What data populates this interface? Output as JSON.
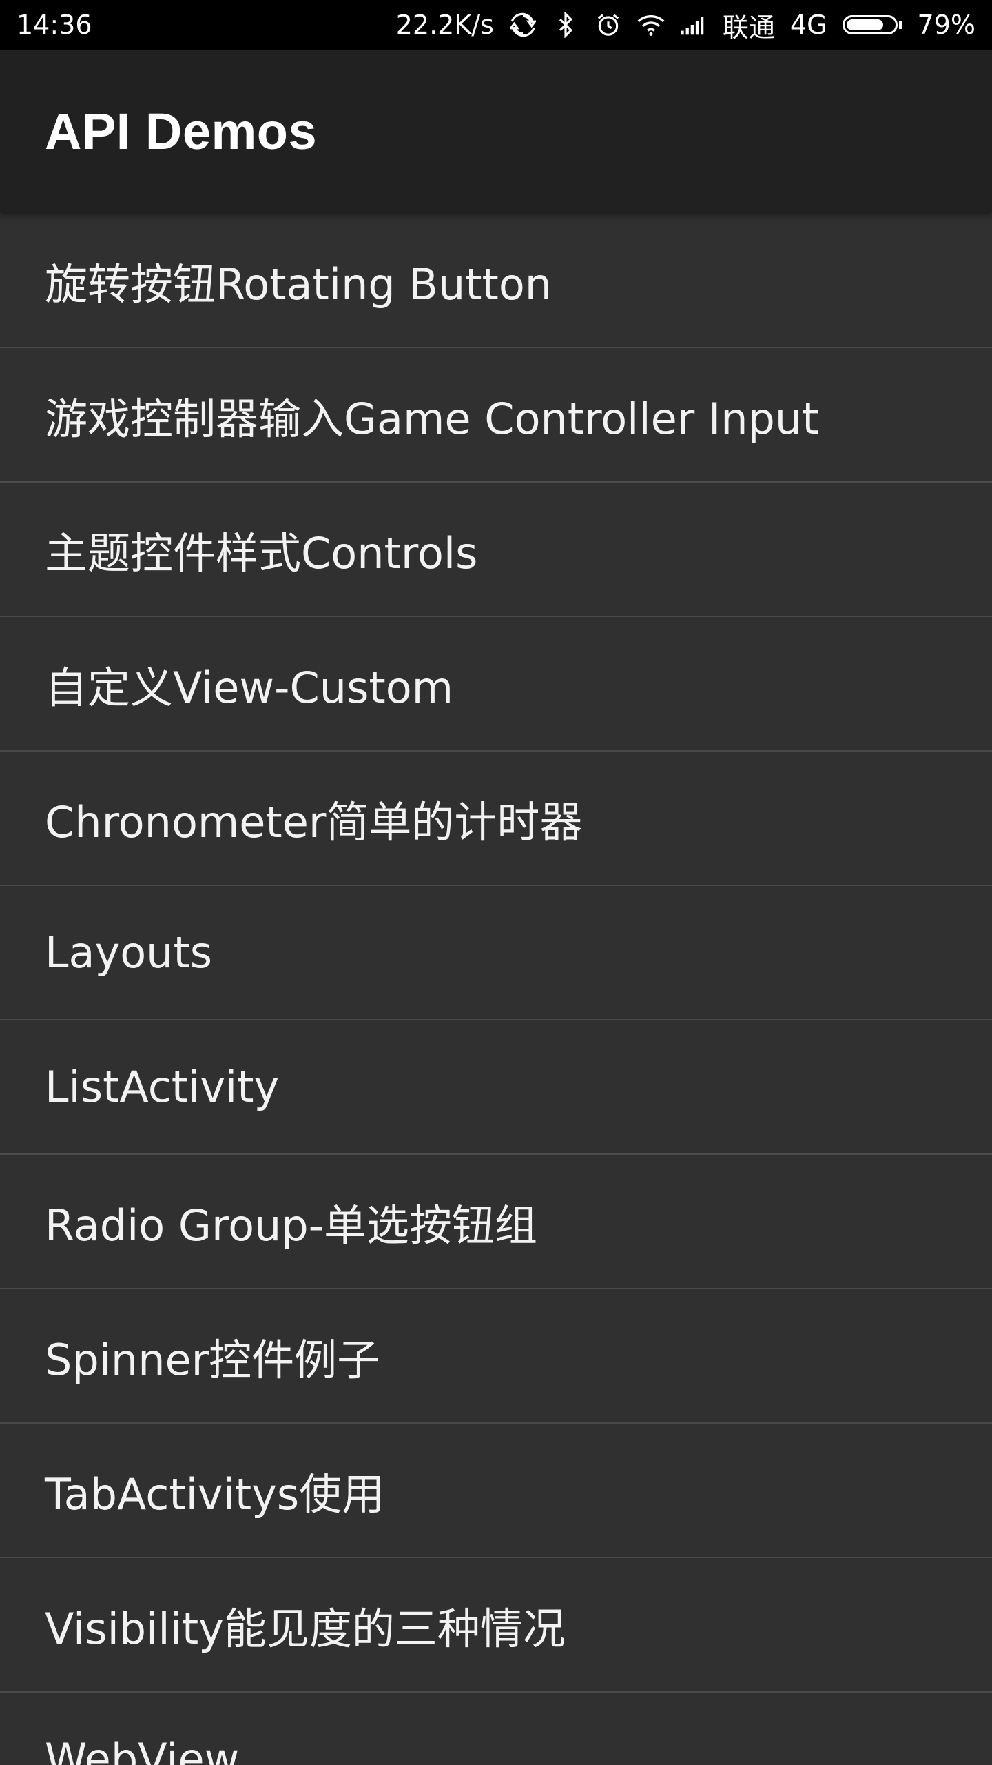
{
  "status_bar": {
    "time": "14:36",
    "net_speed": "22.2K/s",
    "carrier": "联通",
    "network": "4G",
    "battery_percent": "79%",
    "battery_level": 0.79,
    "icons": [
      "sync-icon",
      "bluetooth-icon",
      "alarm-icon",
      "wifi-icon",
      "signal-icon",
      "battery-icon"
    ]
  },
  "app_bar": {
    "title": "API Demos"
  },
  "list": {
    "items": [
      {
        "label": "旋转按钮Rotating Button"
      },
      {
        "label": "游戏控制器输入Game Controller Input"
      },
      {
        "label": "主题控件样式Controls"
      },
      {
        "label": "自定义View-Custom"
      },
      {
        "label": "Chronometer简单的计时器"
      },
      {
        "label": "Layouts"
      },
      {
        "label": "ListActivity"
      },
      {
        "label": "Radio Group-单选按钮组"
      },
      {
        "label": "Spinner控件例子"
      },
      {
        "label": "TabActivitys使用"
      },
      {
        "label": "Visibility能见度的三种情况"
      },
      {
        "label": "WebView"
      }
    ]
  },
  "colors": {
    "status_bar_bg": "#000000",
    "app_bar_bg": "#212121",
    "list_bg": "#303030",
    "divider": "#4a4a4a",
    "text": "#ffffff"
  }
}
